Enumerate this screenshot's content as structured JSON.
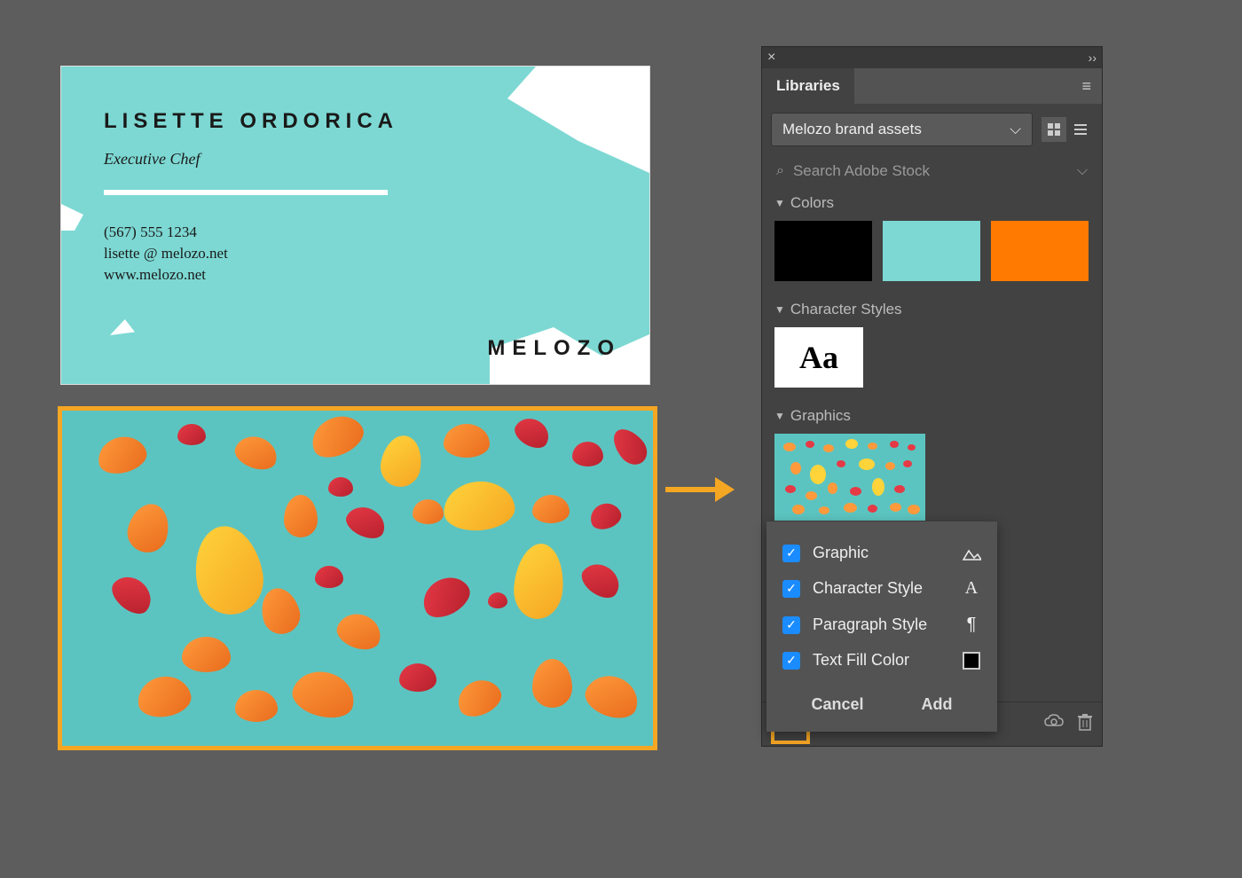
{
  "card": {
    "name": "LISETTE ORDORICA",
    "title": "Executive Chef",
    "phone": "(567) 555 1234",
    "email": "lisette @ melozo.net",
    "website": "www.melozo.net",
    "brand": "MELOZO"
  },
  "panel": {
    "tab": "Libraries",
    "library_name": "Melozo brand assets",
    "search_placeholder": "Search Adobe Stock",
    "sections": {
      "colors": "Colors",
      "character_styles": "Character Styles",
      "graphics": "Graphics"
    },
    "charstyle_sample": "Aa",
    "swatches": [
      "#000000",
      "#7dd8d3",
      "#ff7a00"
    ]
  },
  "popup": {
    "items": [
      {
        "label": "Graphic",
        "icon": "graphic"
      },
      {
        "label": "Character Style",
        "icon": "A"
      },
      {
        "label": "Paragraph Style",
        "icon": "pilcrow"
      },
      {
        "label": "Text Fill Color",
        "icon": "fill"
      }
    ],
    "cancel": "Cancel",
    "add": "Add"
  }
}
